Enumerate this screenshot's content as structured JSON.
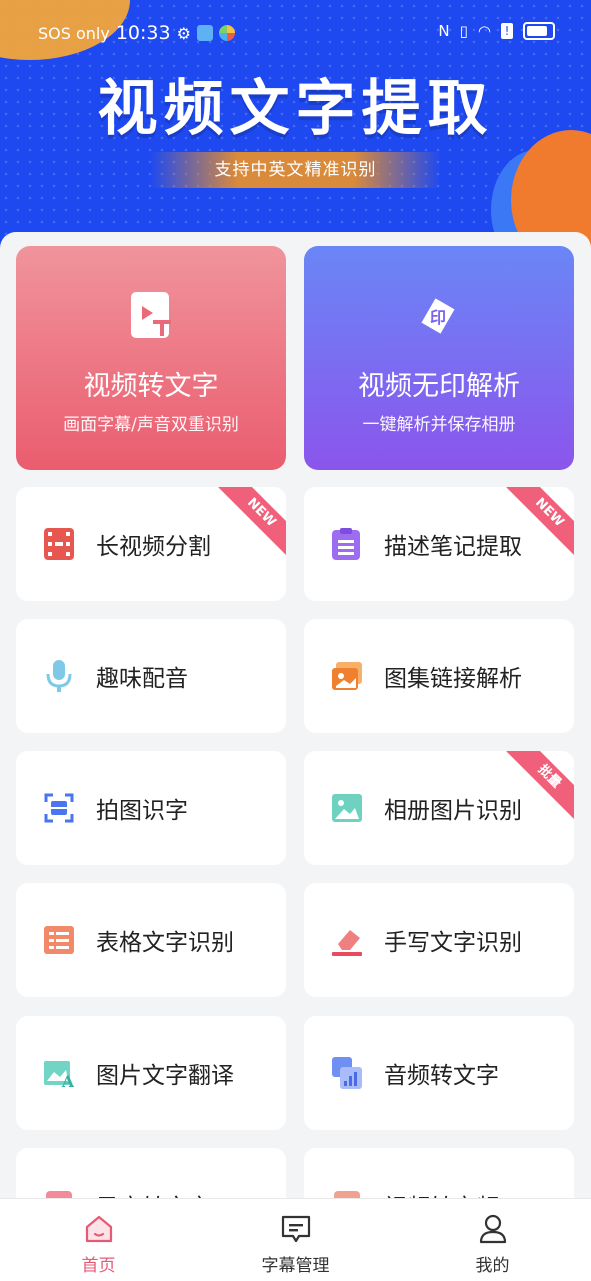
{
  "status_bar": {
    "carrier": "SOS only",
    "time": "10:33",
    "icons": [
      "gear-icon",
      "app-icon",
      "app-icon",
      "nfc-icon",
      "vibrate-icon",
      "wifi-icon",
      "alert-icon",
      "battery-icon"
    ]
  },
  "banner": {
    "title": "视频文字提取",
    "subtitle": "支持中英文精准识别"
  },
  "featured": [
    {
      "title": "视频转文字",
      "subtitle": "画面字幕/声音双重识别",
      "icon": "video-text-icon"
    },
    {
      "title": "视频无印解析",
      "subtitle": "一键解析并保存相册",
      "icon": "stamp-icon"
    }
  ],
  "tiles": [
    {
      "label": "长视频分割",
      "icon": "film-icon",
      "badge": "NEW"
    },
    {
      "label": "描述笔记提取",
      "icon": "clipboard-icon",
      "badge": "NEW"
    },
    {
      "label": "趣味配音",
      "icon": "microphone-icon",
      "badge": ""
    },
    {
      "label": "图集链接解析",
      "icon": "gallery-link-icon",
      "badge": ""
    },
    {
      "label": "拍图识字",
      "icon": "scan-icon",
      "badge": ""
    },
    {
      "label": "相册图片识别",
      "icon": "image-icon",
      "badge": "批量"
    },
    {
      "label": "表格文字识别",
      "icon": "table-icon",
      "badge": ""
    },
    {
      "label": "手写文字识别",
      "icon": "eraser-icon",
      "badge": ""
    },
    {
      "label": "图片文字翻译",
      "icon": "image-translate-icon",
      "badge": ""
    },
    {
      "label": "音频转文字",
      "icon": "audio-text-icon",
      "badge": ""
    },
    {
      "label": "录音转文字",
      "icon": "recorder-icon",
      "badge": ""
    },
    {
      "label": "视频转音频",
      "icon": "video-audio-icon",
      "badge": ""
    }
  ],
  "tabbar": [
    {
      "label": "首页",
      "icon": "home-icon",
      "active": true
    },
    {
      "label": "字幕管理",
      "icon": "subtitle-icon",
      "active": false
    },
    {
      "label": "我的",
      "icon": "user-icon",
      "active": false
    }
  ],
  "colors": {
    "banner_blue": "#1e49f0",
    "featured_red": "#ea5d6f",
    "featured_purple": "#8b55ec",
    "accent_pink": "#e55a75"
  }
}
